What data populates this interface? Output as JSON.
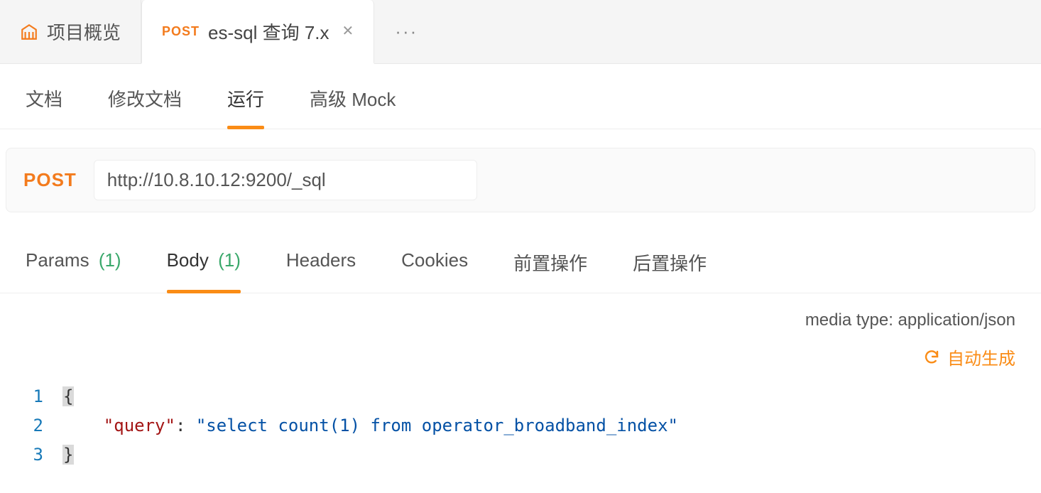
{
  "top_tabs": {
    "overview_label": "项目概览",
    "api_tab": {
      "method": "POST",
      "title": "es-sql 查询 7.x"
    },
    "more": "···"
  },
  "sub_tabs": {
    "doc": "文档",
    "edit_doc": "修改文档",
    "run": "运行",
    "adv_mock": "高级 Mock"
  },
  "request": {
    "method": "POST",
    "url": "http://10.8.10.12:9200/_sql"
  },
  "req_tabs": {
    "params_label": "Params",
    "params_count": "(1)",
    "body_label": "Body",
    "body_count": "(1)",
    "headers": "Headers",
    "cookies": "Cookies",
    "pre": "前置操作",
    "post": "后置操作"
  },
  "body_header": {
    "media_type": "media type: application/json",
    "auto_gen": "自动生成"
  },
  "editor": {
    "line1_num": "1",
    "line2_num": "2",
    "line3_num": "3",
    "brace_open": "{",
    "brace_close": "}",
    "indent": "    ",
    "key_query": "\"query\"",
    "colon": ":",
    "space": " ",
    "val_query": "\"select count(1) from operator_broadband_index\""
  }
}
